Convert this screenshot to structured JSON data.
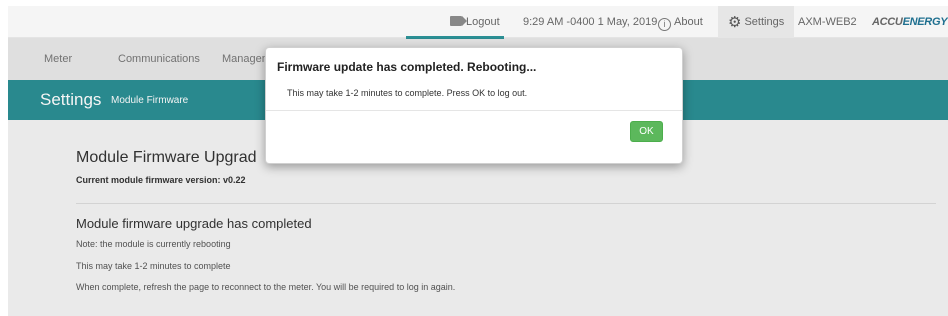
{
  "topbar": {
    "logout_label": "Logout",
    "datetime": "9:29 AM -0400 1 May, 2019",
    "about_label": "About",
    "settings_label": "Settings",
    "device_name": "AXM-WEB2",
    "brand_a": "ACCU",
    "brand_b": "ENERGY"
  },
  "nav": {
    "items": [
      "Meter",
      "Communications",
      "Management"
    ]
  },
  "header": {
    "title": "Settings",
    "subtitle": "Module Firmware"
  },
  "main": {
    "module_title": "Module Firmware Upgrad",
    "version_text": "Current module firmware version: v0.22",
    "status_title": "Module firmware upgrade has completed",
    "lines": [
      "Note: the module is currently rebooting",
      "This may take 1-2 minutes to complete",
      "When complete, refresh the page to reconnect to the meter. You will be required to log in again."
    ]
  },
  "modal": {
    "title": "Firmware update has completed. Rebooting...",
    "body": "This may take 1-2 minutes to complete. Press OK to log out.",
    "ok_label": "OK"
  },
  "colors": {
    "teal": "#2b8f94",
    "ok_green": "#5cb85c"
  },
  "icons": {
    "logout": "logout-icon",
    "about": "info-icon",
    "settings": "gear-icon"
  }
}
